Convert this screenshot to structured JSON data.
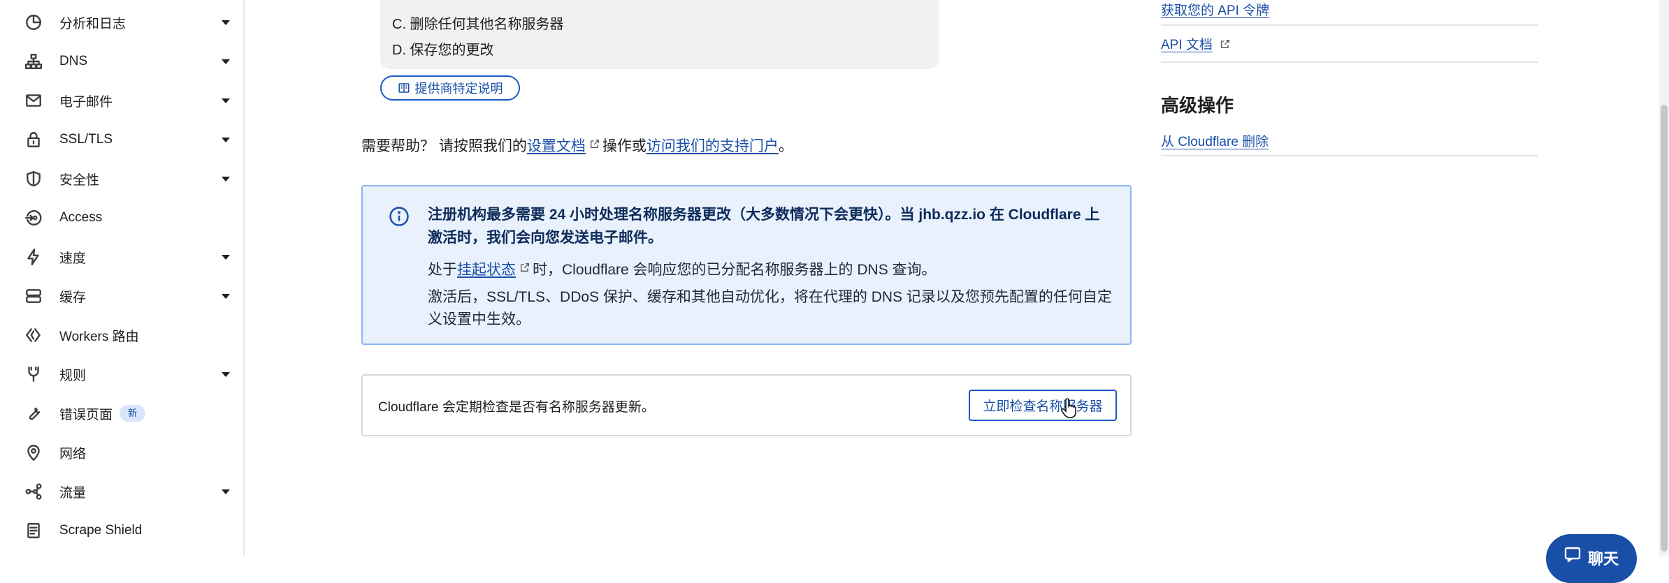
{
  "sidebar": {
    "items": [
      {
        "label": "分析和日志",
        "icon": "chart-pie-icon",
        "caret": true
      },
      {
        "label": "DNS",
        "icon": "sitemap-icon",
        "caret": true
      },
      {
        "label": "电子邮件",
        "icon": "mail-icon",
        "caret": true
      },
      {
        "label": "SSL/TLS",
        "icon": "lock-icon",
        "caret": true
      },
      {
        "label": "安全性",
        "icon": "shield-icon",
        "caret": true
      },
      {
        "label": "Access",
        "icon": "access-icon",
        "caret": false
      },
      {
        "label": "速度",
        "icon": "bolt-icon",
        "caret": true
      },
      {
        "label": "缓存",
        "icon": "server-stack-icon",
        "caret": true
      },
      {
        "label": "Workers 路由",
        "icon": "workers-icon",
        "caret": false
      },
      {
        "label": "规则",
        "icon": "fork-icon",
        "caret": true
      },
      {
        "label": "错误页面",
        "icon": "wrench-icon",
        "caret": false,
        "badge": "新"
      },
      {
        "label": "网络",
        "icon": "map-pin-icon",
        "caret": false
      },
      {
        "label": "流量",
        "icon": "network-icon",
        "caret": true
      },
      {
        "label": "Scrape Shield",
        "icon": "document-icon",
        "caret": false
      }
    ]
  },
  "main": {
    "steps": [
      "C. 删除任何其他名称服务器",
      "D. 保存您的更改"
    ],
    "provider_button": "提供商特定说明",
    "help": {
      "prefix": "需要帮助？ 请按照我们的",
      "setup_docs_link": "设置文档",
      "middle": "操作或",
      "support_portal_link": "访问我们的支持门户",
      "suffix": "。"
    },
    "info": {
      "title": "注册机构最多需要 24 小时处理名称服务器更改（大多数情况下会更快）。当 jhb.qzz.io 在 Cloudflare 上激活时，我们会向您发送电子邮件。",
      "pending_prefix": "处于",
      "pending_link": "挂起状态",
      "pending_suffix": "时，Cloudflare 会响应您的已分配名称服务器上的 DNS 查询。",
      "activation": "激活后，SSL/TLS、DDoS 保护、缓存和其他自动优化，将在代理的 DNS 记录以及您预先配置的任何自定义设置中生效。"
    },
    "check": {
      "text": "Cloudflare 会定期检查是否有名称服务器更新。",
      "button": "立即检查名称服务器"
    }
  },
  "right": {
    "api_token_link": "获取您的 API 令牌",
    "api_docs_link": "API 文档",
    "advanced_heading": "高级操作",
    "remove_link": "从 Cloudflare 删除"
  },
  "chat": {
    "label": "聊天"
  },
  "colors": {
    "accent": "#1a4fa8",
    "info_bg": "#e9f1fc",
    "info_border": "#8ab4ee"
  }
}
